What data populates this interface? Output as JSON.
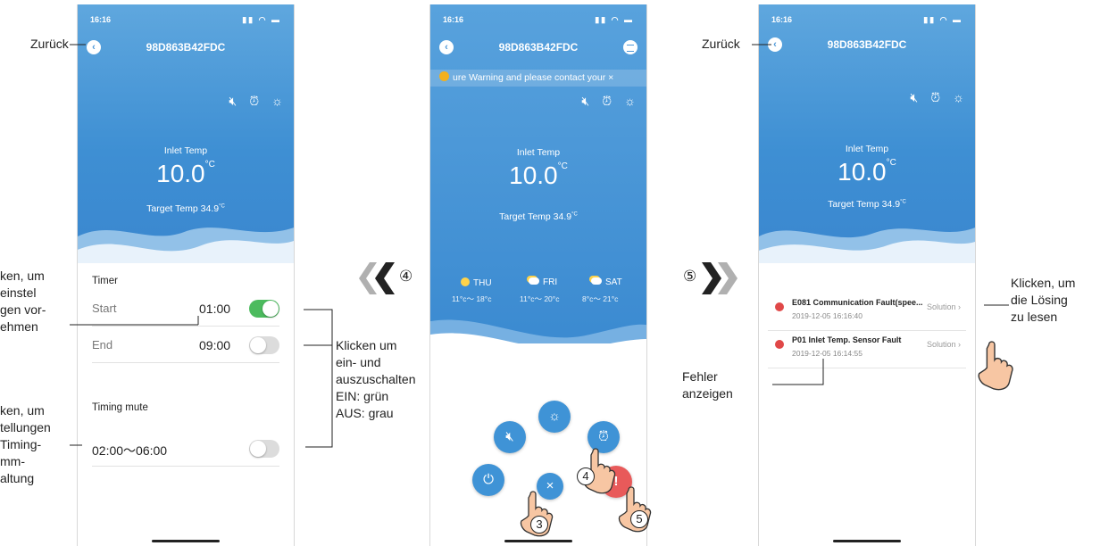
{
  "phone1": {
    "status_time": "16:16",
    "device_title": "98D863B42FDC",
    "inlet_label": "Inlet Temp",
    "inlet_value": "10.0",
    "inlet_unit": "°C",
    "target_label": "Target Temp",
    "target_value": "34.9",
    "target_unit": "°C",
    "timer_heading": "Timer",
    "start_label": "Start",
    "start_value": "01:00",
    "start_toggle_on": true,
    "end_label": "End",
    "end_value": "09:00",
    "end_toggle_on": false,
    "mute_heading": "Timing mute",
    "mute_value": "02:00～06:00",
    "mute_toggle_on": false
  },
  "phone2": {
    "status_time": "16:16",
    "device_title": "98D863B42FDC",
    "warning_text": "ure Warning and please contact your ×",
    "inlet_label": "Inlet Temp",
    "inlet_value": "10.0",
    "inlet_unit": "°C",
    "target_label": "Target Temp",
    "target_value": "34.9",
    "target_unit": "°C",
    "forecast": [
      {
        "day": "THU",
        "range": "11°c～ 18°c",
        "icon": "sun-icon"
      },
      {
        "day": "FRI",
        "range": "11°c～ 20°c",
        "icon": "partly-cloudy-icon"
      },
      {
        "day": "SAT",
        "range": "8°c～ 21°c",
        "icon": "partly-cloudy-icon"
      }
    ]
  },
  "phone3": {
    "status_time": "16:16",
    "device_title": "98D863B42FDC",
    "inlet_label": "Inlet Temp",
    "inlet_value": "10.0",
    "inlet_unit": "°C",
    "target_label": "Target Temp",
    "target_value": "34.9",
    "target_unit": "°C",
    "faults": [
      {
        "title": "E081 Communication Fault(spee...",
        "date": "2019-12-05 16:16:40",
        "action": "Solution"
      },
      {
        "title": "P01 Inlet Temp. Sensor Fault",
        "date": "2019-12-05 16:14:55",
        "action": "Solution"
      }
    ]
  },
  "annotations": {
    "back_left": "Zurück",
    "back_right": "Zurück",
    "timer_note": [
      "ken, um",
      "einstel",
      "gen vor-",
      "ehmen"
    ],
    "mute_note": [
      "ken, um",
      "tellungen",
      "Timing-",
      "mm-",
      "altung"
    ],
    "toggle_note": [
      "Klicken um",
      "ein- und",
      "auszuschalten",
      "EIN: grün",
      "AUS: grau"
    ],
    "solution_note": [
      "Klicken, um",
      "die Lösing",
      "zu lesen"
    ],
    "fault_note": [
      "Fehler",
      "anzeigen"
    ],
    "step3": "3",
    "step4": "4",
    "step5": "5",
    "chevron_step4": "④",
    "chevron_step5": "⑤"
  },
  "colors": {
    "hero_blue": "#3e8fd3",
    "toggle_on": "#4cbb5e",
    "toggle_off": "#dcdcdc",
    "alert_red": "#e85a5a",
    "chevron_dark": "#222222",
    "chevron_light": "#b0b0b0"
  }
}
